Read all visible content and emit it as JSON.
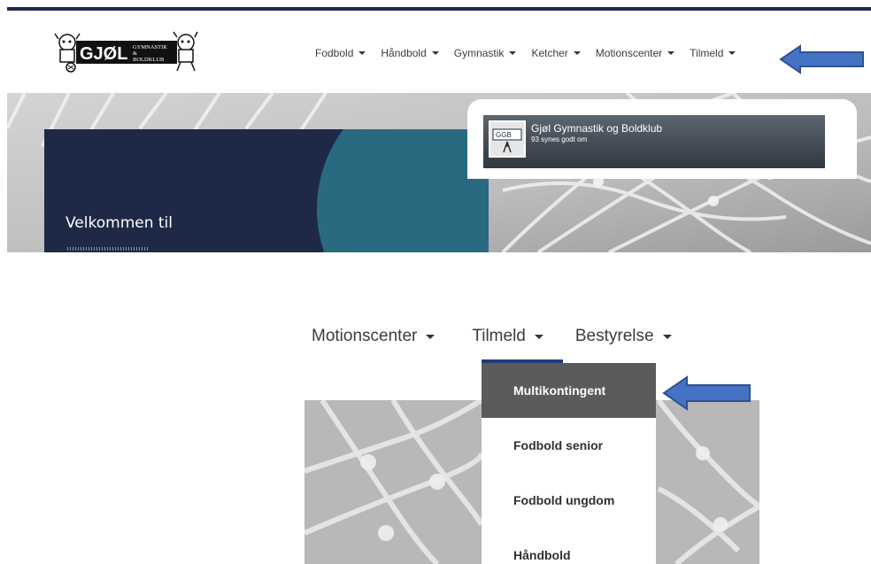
{
  "site": {
    "logo_text": "GJØL",
    "logo_sub1": "GYMNASTIK",
    "logo_amp": "&",
    "logo_sub2": "BOLDKLUB"
  },
  "nav": {
    "items": [
      {
        "label": "Fodbold"
      },
      {
        "label": "Håndbold"
      },
      {
        "label": "Gymnastik"
      },
      {
        "label": "Ketcher"
      },
      {
        "label": "Motionscenter"
      },
      {
        "label": "Tilmeld"
      }
    ]
  },
  "hero": {
    "welcome": "Velkommen til"
  },
  "facebook": {
    "page_name": "Gjøl Gymnastik og Boldklub",
    "likes": "93 synes godt om",
    "avatar_text": "GGB"
  },
  "zoom": {
    "nav_items": [
      {
        "label": "Motionscenter"
      },
      {
        "label": "Tilmeld"
      },
      {
        "label": "Bestyrelse"
      }
    ],
    "dropdown": [
      {
        "label": "Multikontingent",
        "active": true
      },
      {
        "label": "Fodbold senior"
      },
      {
        "label": "Fodbold ungdom"
      },
      {
        "label": "Håndbold"
      }
    ]
  },
  "colors": {
    "arrow_fill": "#4472c4",
    "arrow_stroke": "#2f528f",
    "panel": "#1d2947",
    "accent_circle": "#2a6a80",
    "active_item": "#5b5b5b"
  },
  "icons": {
    "caret": "chevron-down-icon",
    "arrow": "left-arrow-icon"
  }
}
